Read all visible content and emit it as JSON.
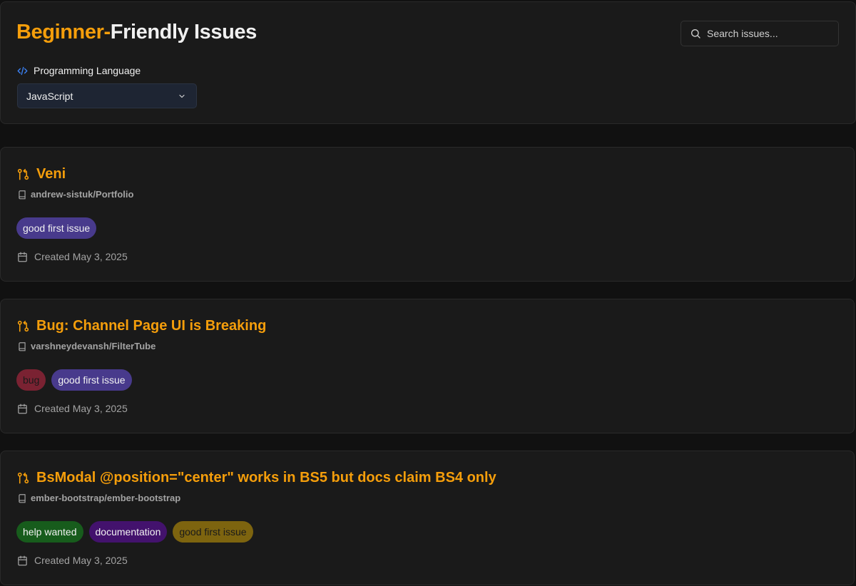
{
  "header": {
    "title_part1": "Beginner-",
    "title_part2": "Friendly Issues",
    "search_placeholder": "Search issues..."
  },
  "filter": {
    "label": "Programming Language",
    "selected": "JavaScript"
  },
  "icons": {
    "search": "search-icon",
    "code": "code-icon",
    "chevron": "chevron-down-icon",
    "issue": "git-pull-request-icon",
    "repo": "book-icon",
    "date": "calendar-icon"
  },
  "colors": {
    "accent": "#f59e0b",
    "code_icon": "#3b82f6"
  },
  "issues": [
    {
      "title": "Veni",
      "repo": "andrew-sistuk/Portfolio",
      "labels": [
        {
          "text": "good first issue",
          "bg": "#483a8c",
          "fg": "#f2f2f2"
        }
      ],
      "created": "Created May 3, 2025"
    },
    {
      "title": "Bug: Channel Page UI is Breaking",
      "repo": "varshneydevansh/FilterTube",
      "labels": [
        {
          "text": "bug",
          "bg": "#7a2232",
          "fg": "#1a1a1a"
        },
        {
          "text": "good first issue",
          "bg": "#483a8c",
          "fg": "#f2f2f2"
        }
      ],
      "created": "Created May 3, 2025"
    },
    {
      "title": "BsModal @position=\"center\" works in BS5 but docs claim BS4 only",
      "repo": "ember-bootstrap/ember-bootstrap",
      "labels": [
        {
          "text": "help wanted",
          "bg": "#175c1c",
          "fg": "#f2f2f2"
        },
        {
          "text": "documentation",
          "bg": "#43126d",
          "fg": "#f2f2f2"
        },
        {
          "text": "good first issue",
          "bg": "#7d640f",
          "fg": "#1a1a1a"
        }
      ],
      "created": "Created May 3, 2025"
    }
  ]
}
